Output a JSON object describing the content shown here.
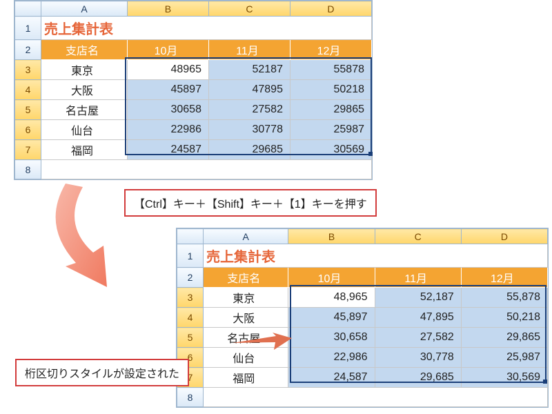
{
  "title": "売上集計表",
  "cols": [
    "A",
    "B",
    "C",
    "D"
  ],
  "rownums": [
    "1",
    "2",
    "3",
    "4",
    "5",
    "6",
    "7",
    "8"
  ],
  "header": {
    "name": "支店名",
    "months": [
      "10月",
      "11月",
      "12月"
    ]
  },
  "rows": [
    {
      "name": "東京",
      "before": [
        "48965",
        "52187",
        "55878"
      ],
      "after": [
        "48,965",
        "52,187",
        "55,878"
      ]
    },
    {
      "name": "大阪",
      "before": [
        "45897",
        "47895",
        "50218"
      ],
      "after": [
        "45,897",
        "47,895",
        "50,218"
      ]
    },
    {
      "name": "名古屋",
      "before": [
        "30658",
        "27582",
        "29865"
      ],
      "after": [
        "30,658",
        "27,582",
        "29,865"
      ]
    },
    {
      "name": "仙台",
      "before": [
        "22986",
        "30778",
        "25987"
      ],
      "after": [
        "22,986",
        "30,778",
        "25,987"
      ]
    },
    {
      "name": "福岡",
      "before": [
        "24587",
        "29685",
        "30569"
      ],
      "after": [
        "24,587",
        "29,685",
        "30,569"
      ]
    }
  ],
  "callout1": "【Ctrl】キー＋【Shift】キー＋【1】キーを押す",
  "callout2": "桁区切りスタイルが設定された",
  "chart_data": {
    "type": "table",
    "title": "売上集計表",
    "categories": [
      "10月",
      "11月",
      "12月"
    ],
    "series": [
      {
        "name": "東京",
        "values": [
          48965,
          52187,
          55878
        ]
      },
      {
        "name": "大阪",
        "values": [
          45897,
          47895,
          50218
        ]
      },
      {
        "name": "名古屋",
        "values": [
          30658,
          27582,
          29865
        ]
      },
      {
        "name": "仙台",
        "values": [
          22986,
          30778,
          25987
        ]
      },
      {
        "name": "福岡",
        "values": [
          24587,
          29685,
          30569
        ]
      }
    ]
  }
}
